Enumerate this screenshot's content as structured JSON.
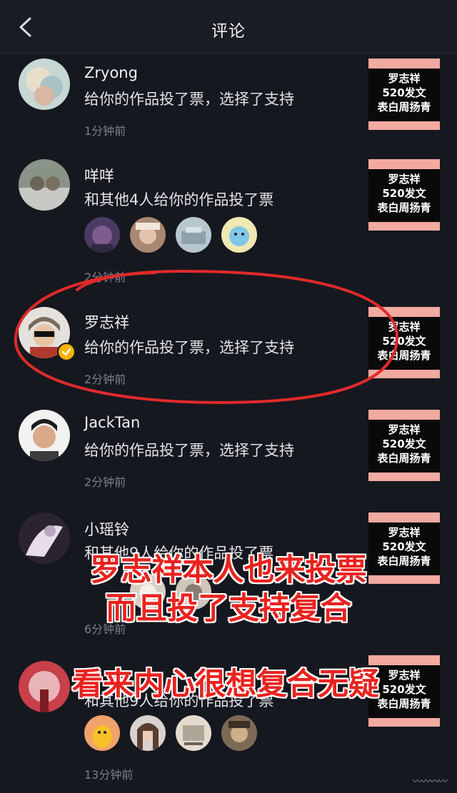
{
  "header": {
    "title": "评论"
  },
  "thumb_lines": [
    "罗志祥",
    "520发文",
    "表白周扬青"
  ],
  "notifications": [
    {
      "username": "Zryong",
      "message": "给你的作品投了票，选择了支持",
      "time": "1分钟前"
    },
    {
      "username": "咩咩",
      "message": "和其他4人给你的作品投了票",
      "time": "2分钟前"
    },
    {
      "username": "罗志祥",
      "message": "给你的作品投了票，选择了支持",
      "time": "2分钟前"
    },
    {
      "username": "JackTan",
      "message": "给你的作品投了票，选择了支持",
      "time": "2分钟前"
    },
    {
      "username": "小瑶铃",
      "message": "和其他9人给你的作品投了票",
      "time": "6分钟前"
    },
    {
      "username": "",
      "message": "和其他9人给你的作品投了票",
      "time": "13分钟前"
    }
  ],
  "overlay": {
    "line1": "罗志祥本人也来投票",
    "line2": "而且投了支持复合",
    "line3": "看来内心很想复合无疑"
  },
  "colors": {
    "background": "#16181f",
    "overlay_text": "#e8231f",
    "highlight_ring": "#e02a2a",
    "thumb_border": "#f2a9a0"
  }
}
